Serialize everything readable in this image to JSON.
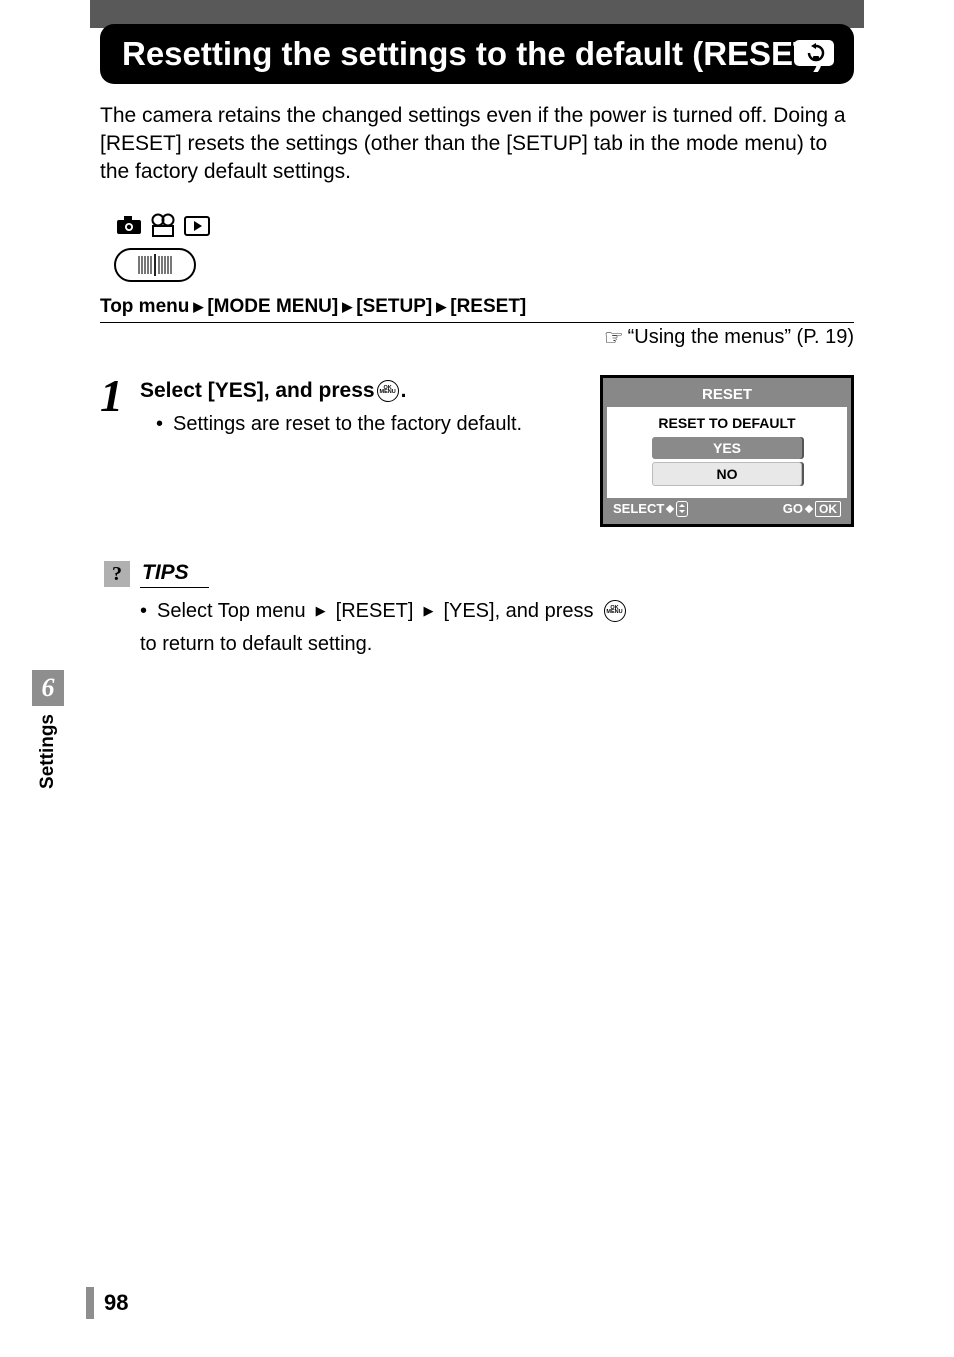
{
  "title": "Resetting the settings to the default (RESET)",
  "intro": "The camera retains the changed settings even if the power is turned off. Doing a [RESET] resets the settings (other than the [SETUP] tab in the mode menu) to the factory default settings.",
  "breadcrumb": {
    "lead": "Top menu",
    "items": [
      "[MODE MENU]",
      "[SETUP]",
      "[RESET]"
    ]
  },
  "reference": "“Using the menus” (P. 19)",
  "step": {
    "number": "1",
    "heading_before": "Select [YES], and press ",
    "heading_after": ".",
    "ok_top": "OK",
    "ok_bottom": "MENU",
    "bullet": "Settings are reset to the factory default."
  },
  "screen": {
    "title": "RESET",
    "subtitle": "RESET TO DEFAULT",
    "option_yes": "YES",
    "option_no": "NO",
    "footer_select": "SELECT",
    "footer_go": "GO",
    "footer_ok": "OK"
  },
  "tips": {
    "label": "TIPS",
    "text_1": "Select Top menu ",
    "text_2": " [RESET] ",
    "text_3": " [YES], and press ",
    "text_4": " to return to default setting.",
    "ok_top": "OK",
    "ok_bottom": "MENU"
  },
  "side": {
    "chapter": "6",
    "label": "Settings"
  },
  "page_number": "98"
}
